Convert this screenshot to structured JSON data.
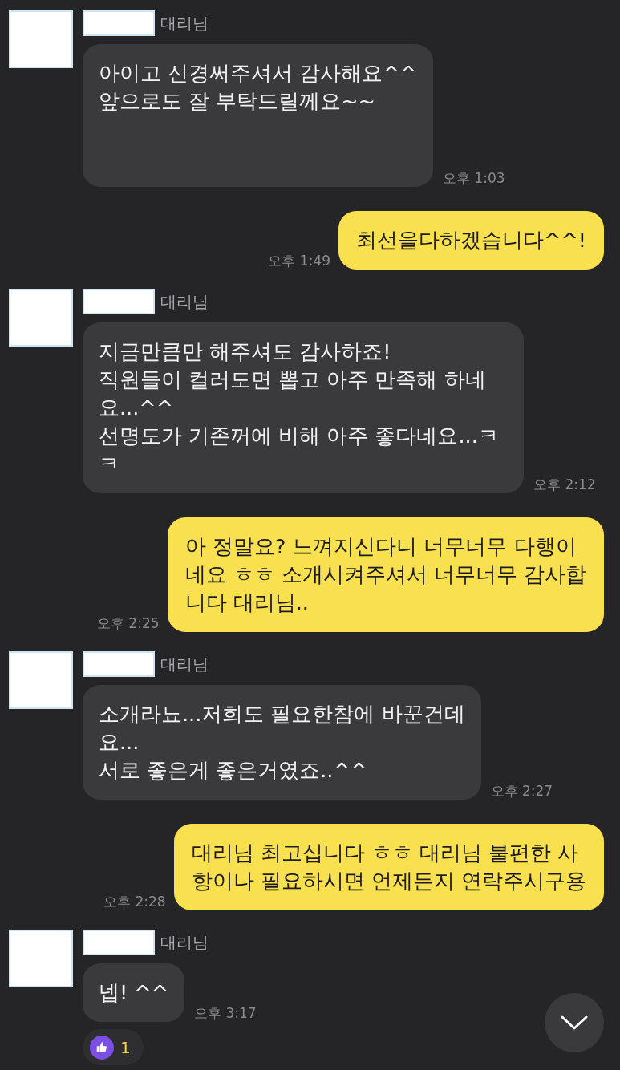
{
  "messages": [
    {
      "kind": "incoming",
      "sender": {
        "title": "대리님"
      },
      "text": "아이고 신경써주셔서 감사해요^^\n앞으로도 잘 부탁드릴께요~~\n\n\n",
      "time": "오후 1:03"
    },
    {
      "kind": "outgoing",
      "text": "최선을다하겠습니다^^!",
      "time": "오후 1:49"
    },
    {
      "kind": "incoming",
      "sender": {
        "title": "대리님"
      },
      "text": "지금만큼만 해주셔도 감사하죠!\n직원들이 컬러도면 뽑고 아주 만족해 하네\n요...^^\n선명도가 기존꺼에 비해 아주 좋다네요...ㅋㅋ",
      "time": "오후 2:12"
    },
    {
      "kind": "outgoing",
      "text": "아 정말요? 느껴지신다니 너무너무 다행이\n네요 ㅎㅎ 소개시켜주셔서 너무너무 감사합\n니다 대리님..",
      "time": "오후 2:25"
    },
    {
      "kind": "incoming",
      "sender": {
        "title": "대리님"
      },
      "text": "소개라뇨...저희도 필요한참에 바꾼건데\n요...\n서로 좋은게 좋은거였죠..^^",
      "time": "오후 2:27"
    },
    {
      "kind": "outgoing",
      "text": "대리님 최고십니다 ㅎㅎ 대리님 불편한 사\n항이나 필요하시면 언제든지 연락주시구용",
      "time": "오후 2:28"
    },
    {
      "kind": "incoming",
      "sender": {
        "title": "대리님"
      },
      "text": "넵! ^^",
      "time": "오후 3:17",
      "reactions": [
        {
          "count": "1"
        }
      ]
    }
  ]
}
